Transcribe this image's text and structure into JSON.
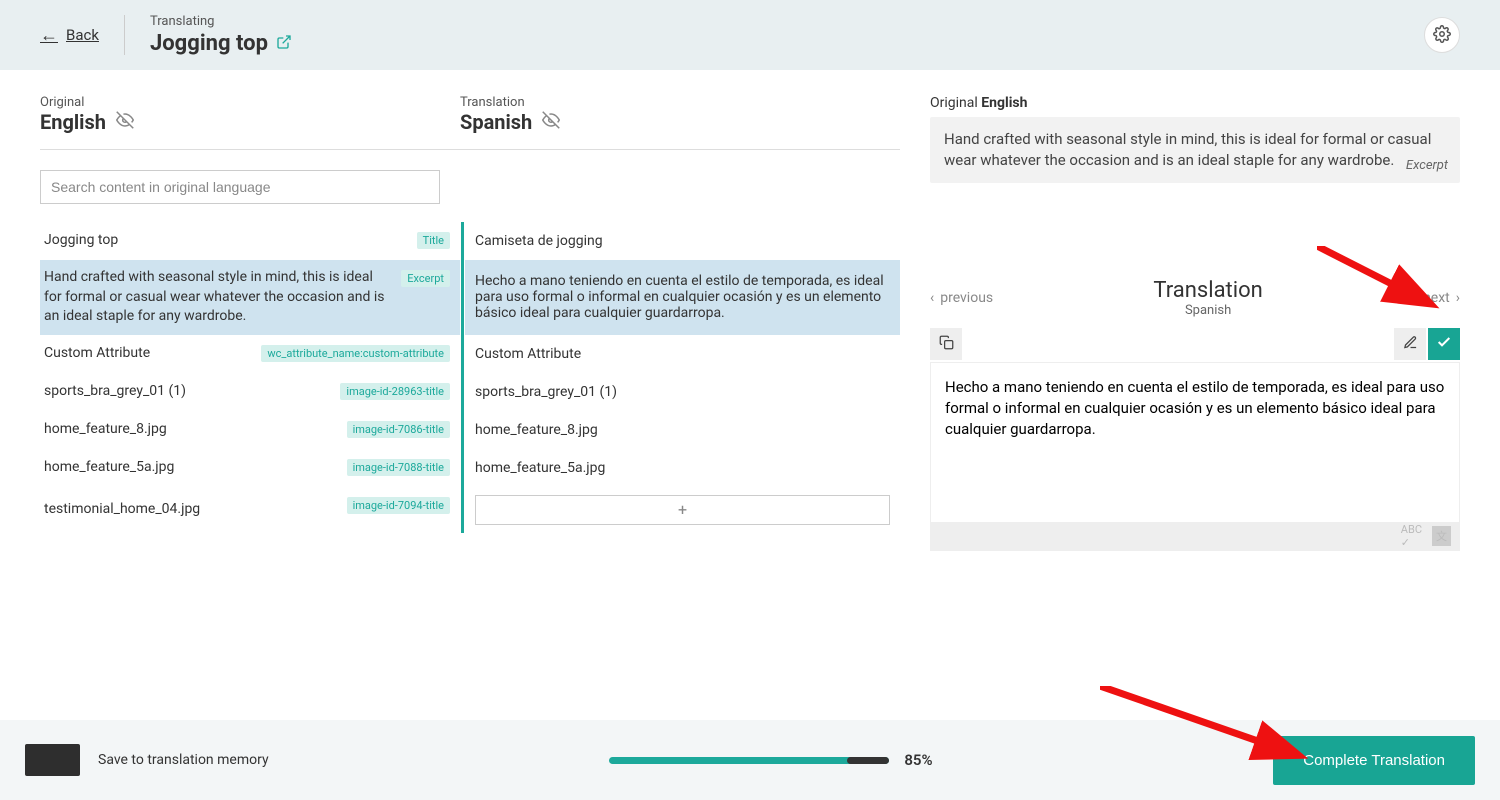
{
  "header": {
    "back_label": "Back",
    "translating_label": "Translating",
    "title": "Jogging top"
  },
  "langs": {
    "original_label": "Original",
    "original_name": "English",
    "translation_label": "Translation",
    "translation_name": "Spanish"
  },
  "search": {
    "placeholder": "Search content in original language"
  },
  "rows": [
    {
      "orig": "Jogging top",
      "badge": "Title",
      "trans": "Camiseta de jogging",
      "active": false
    },
    {
      "orig": "Hand crafted with seasonal style in mind, this is ideal for formal or casual wear whatever the occasion and is an ideal staple for any wardrobe.",
      "badge": "Excerpt",
      "trans": "Hecho a mano teniendo en cuenta el estilo de temporada, es ideal para uso formal o informal en cualquier ocasión y es un elemento básico ideal para cualquier guardarropa.",
      "active": true
    },
    {
      "orig": "Custom Attribute",
      "badge": "wc_attribute_name:custom-attribute",
      "trans": "Custom Attribute",
      "active": false
    },
    {
      "orig": "sports_bra_grey_01 (1)",
      "badge": "image-id-28963-title",
      "trans": "sports_bra_grey_01 (1)",
      "active": false
    },
    {
      "orig": "home_feature_8.jpg",
      "badge": "image-id-7086-title",
      "trans": "home_feature_8.jpg",
      "active": false
    },
    {
      "orig": "home_feature_5a.jpg",
      "badge": "image-id-7088-title",
      "trans": "home_feature_5a.jpg",
      "active": false
    },
    {
      "orig": "testimonial_home_04.jpg",
      "badge": "image-id-7094-title",
      "trans": "",
      "active": false
    }
  ],
  "preview": {
    "original_label_prefix": "Original",
    "original_lang": "English",
    "original_text": "Hand crafted with seasonal style in mind, this is ideal for formal or casual wear whatever the occasion and is an ideal staple for any wardrobe.",
    "original_tag": "Excerpt",
    "prev_label": "previous",
    "next_label": "next",
    "translation_title": "Translation",
    "translation_lang": "Spanish",
    "translation_text": "Hecho a mano teniendo en cuenta el estilo de temporada, es ideal para uso formal o informal en cualquier ocasión y es un elemento básico ideal para cualquier guardarropa."
  },
  "footer": {
    "save_label": "Save to translation memory",
    "progress_pct": "85%",
    "complete_label": "Complete Translation"
  }
}
